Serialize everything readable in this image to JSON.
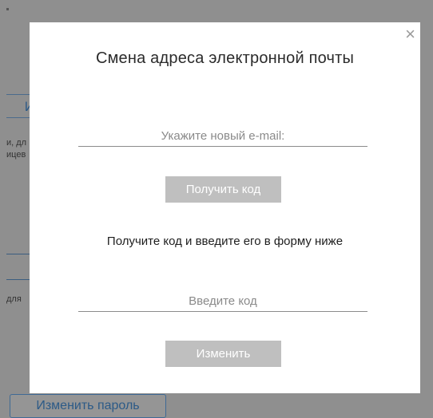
{
  "background": {
    "tab_label": "И",
    "text_lines": [
      "и, дл",
      "ицев"
    ],
    "text2": "для",
    "change_password_label": "Изменить пароль"
  },
  "modal": {
    "close_glyph": "×",
    "title": "Смена адреса электронной почты",
    "email_placeholder": "Укажите новый e-mail:",
    "get_code_label": "Получить код",
    "hint": "Получите код и введите его в форму ниже",
    "code_placeholder": "Введите код",
    "change_label": "Изменить"
  },
  "colors": {
    "overlay": "#8f8f8f",
    "button_disabled": "#bfbfbf",
    "link_blue": "#2c5a87"
  }
}
